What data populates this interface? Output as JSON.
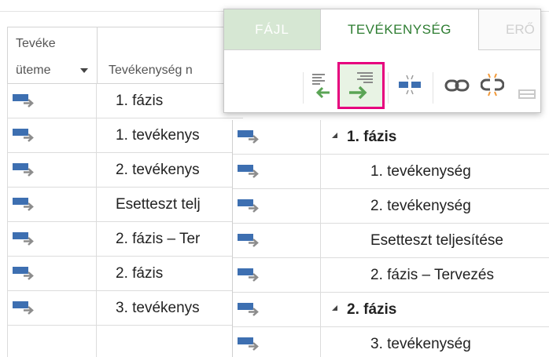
{
  "back_grid": {
    "header_col1_line1": "Tevéke",
    "header_col1_line2": "üteme",
    "header_col2": "Tevékenység n",
    "rows": [
      {
        "name": "1. fázis"
      },
      {
        "name": "1. tevékenys"
      },
      {
        "name": "2. tevékenys"
      },
      {
        "name": "Esetteszt telj"
      },
      {
        "name": "2. fázis – Ter"
      },
      {
        "name": "2. fázis"
      },
      {
        "name": "3. tevékenys"
      }
    ]
  },
  "front_grid": {
    "rows": [
      {
        "name": "1. fázis",
        "summary": true
      },
      {
        "name": "1. tevékenység",
        "summary": false
      },
      {
        "name": "2. tevékenység",
        "summary": false
      },
      {
        "name": "Esetteszt teljesítése",
        "summary": false
      },
      {
        "name": "2. fázis – Tervezés",
        "summary": false
      },
      {
        "name": "2. fázis",
        "summary": true
      },
      {
        "name": "3. tevékenység",
        "summary": false
      }
    ]
  },
  "ribbon": {
    "tabs": [
      {
        "label": "FÁJL",
        "state": "inactive"
      },
      {
        "label": "TEVÉKENYSÉG",
        "state": "active"
      },
      {
        "label": "ERŐ",
        "state": "inactive"
      }
    ],
    "commands": [
      {
        "icon": "outdent-task-icon"
      },
      {
        "icon": "indent-task-icon",
        "highlighted": true
      },
      {
        "icon": "split-task-icon"
      },
      {
        "icon": "link-tasks-icon"
      },
      {
        "icon": "unlink-tasks-icon"
      }
    ]
  },
  "colors": {
    "task_icon_blue": "#3d6fb1",
    "arrow_green": "#5aa455",
    "active_tab_text": "#2e7d32",
    "file_tab_bg": "#d6e7d3",
    "highlight_border": "#e6007e"
  }
}
